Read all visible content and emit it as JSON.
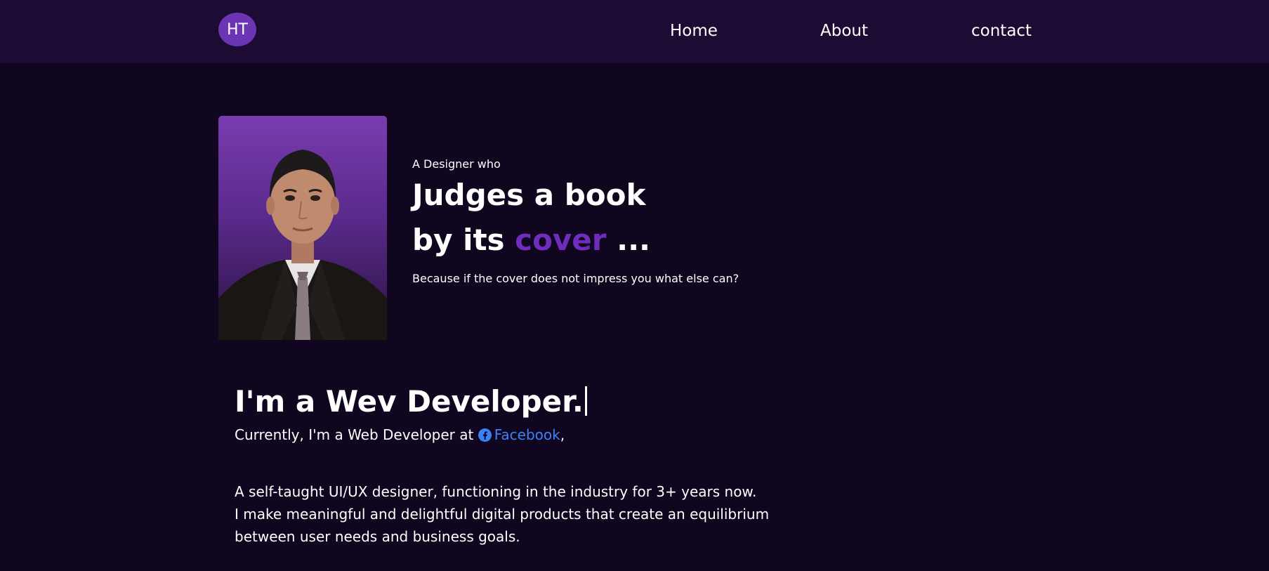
{
  "nav": {
    "logo_text": "HT",
    "links": [
      {
        "label": "Home"
      },
      {
        "label": "About"
      },
      {
        "label": "contact"
      }
    ]
  },
  "hero": {
    "eyebrow": "A Designer who",
    "headline_line1": "Judges a book",
    "headline_line2_prefix": "by its ",
    "headline_line2_accent": "cover",
    "headline_line2_suffix": " ...",
    "tagline": "Because if the cover does not impress you what else can?"
  },
  "intro": {
    "role_heading": "I'm a Wev Developer.",
    "current_prefix": "Currently, I'm a Web Developer at ",
    "company": "Facebook",
    "current_suffix": ",",
    "bio_lines": [
      "A self-taught UI/UX designer, functioning in the industry for 3+ years now.",
      "I make meaningful and delightful digital products that create an equilibrium",
      "between user needs and business goals."
    ]
  },
  "colors": {
    "background": "#10061f",
    "navbar": "#1c0b33",
    "logo_bg": "#6b35b5",
    "accent": "#6f2dbd",
    "link": "#3b82f6"
  },
  "icons": {
    "facebook": "facebook-icon"
  }
}
